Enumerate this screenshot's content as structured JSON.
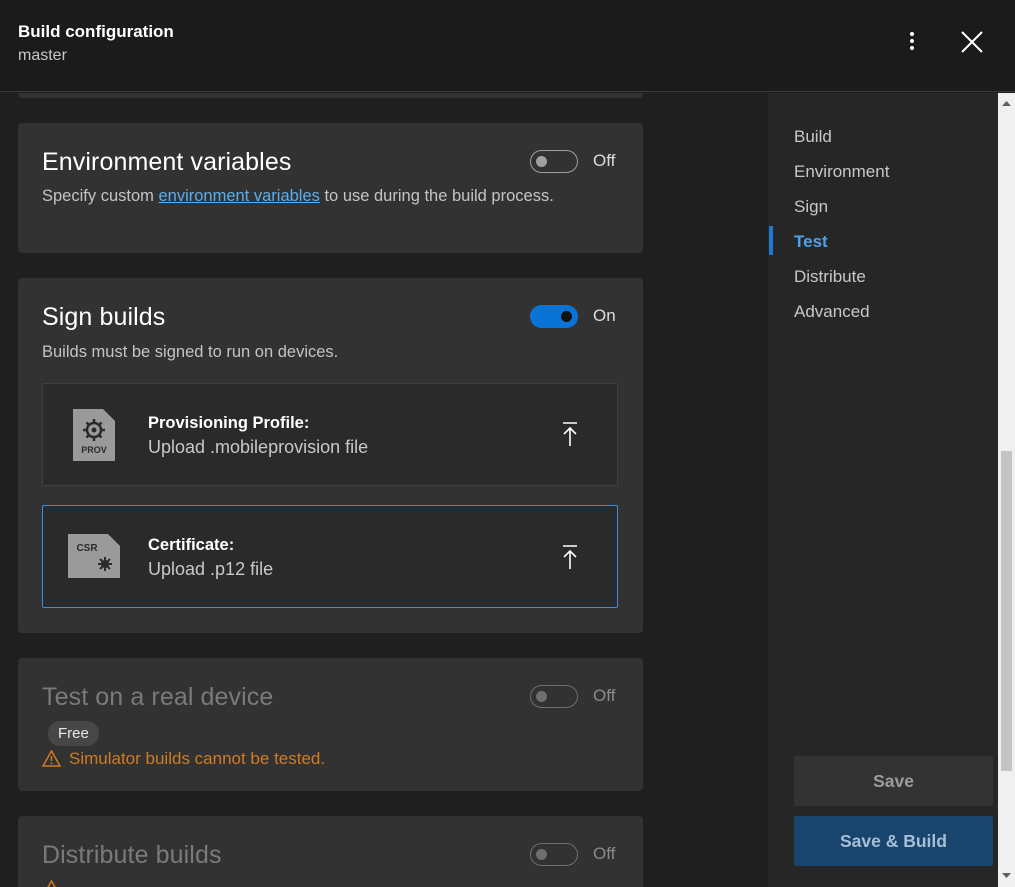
{
  "header": {
    "title": "Build configuration",
    "subtitle": "master"
  },
  "environment": {
    "title": "Environment variables",
    "toggle_label": "Off",
    "desc_before": "Specify custom ",
    "desc_link": "environment variables",
    "desc_after": " to use during the build process."
  },
  "sign": {
    "title": "Sign builds",
    "toggle_label": "On",
    "desc": "Builds must be signed to run on devices.",
    "profile": {
      "icon_text": "PROV",
      "label": "Provisioning Profile:",
      "hint": "Upload .mobileprovision file"
    },
    "certificate": {
      "icon_text": "CSR",
      "label": "Certificate:",
      "hint": "Upload .p12 file"
    }
  },
  "test": {
    "title": "Test on a real device",
    "toggle_label": "Off",
    "badge": "Free",
    "warning": "Simulator builds cannot be tested."
  },
  "distribute": {
    "title": "Distribute builds",
    "toggle_label": "Off"
  },
  "sidebar": {
    "items": [
      {
        "label": "Build"
      },
      {
        "label": "Environment"
      },
      {
        "label": "Sign"
      },
      {
        "label": "Test"
      },
      {
        "label": "Distribute"
      },
      {
        "label": "Advanced"
      }
    ],
    "active": "Test",
    "save_label": "Save",
    "save_build_label": "Save & Build"
  },
  "colors": {
    "accent": "#0a74d6",
    "warning": "#d27a22",
    "link": "#5aaeee"
  }
}
